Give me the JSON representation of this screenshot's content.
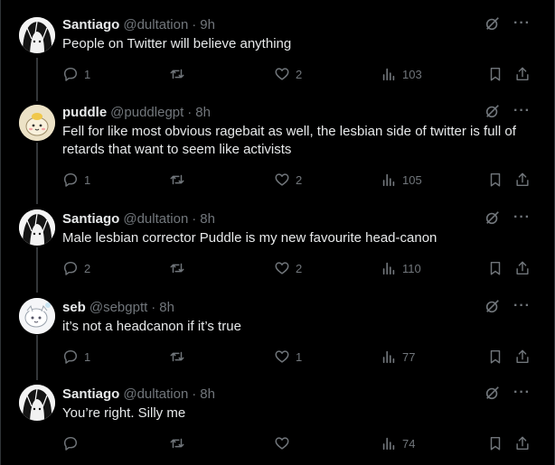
{
  "tweets": [
    {
      "name": "Santiago",
      "handle": "@dultation",
      "time": "9h",
      "text": "People on Twitter will believe anything",
      "replies": "1",
      "reposts": "",
      "likes": "2",
      "views": "103",
      "avatar": "anime-avatar"
    },
    {
      "name": "puddle",
      "handle": "@puddlegpt",
      "time": "8h",
      "text": "Fell for like most obvious ragebait as well, the lesbian side of twitter is full of retards that want to seem like activists",
      "replies": "1",
      "reposts": "",
      "likes": "2",
      "views": "105",
      "avatar": "cartoon-avatar"
    },
    {
      "name": "Santiago",
      "handle": "@dultation",
      "time": "8h",
      "text": "Male lesbian corrector Puddle is my new favourite head-canon",
      "replies": "2",
      "reposts": "",
      "likes": "2",
      "views": "110",
      "avatar": "anime-avatar"
    },
    {
      "name": "seb",
      "handle": "@sebgptt",
      "time": "8h",
      "text": "it’s not a headcanon if it’s true",
      "replies": "1",
      "reposts": "",
      "likes": "1",
      "views": "77",
      "avatar": "sketch-avatar"
    },
    {
      "name": "Santiago",
      "handle": "@dultation",
      "time": "8h",
      "text": "You’re right. Silly me",
      "replies": "",
      "reposts": "",
      "likes": "",
      "views": "74",
      "avatar": "anime-avatar"
    }
  ],
  "separator": "·",
  "more_glyph": "···",
  "colors": {
    "background": "#000000",
    "text": "#e7e9ea",
    "muted": "#71767b",
    "thread_line": "#333639"
  },
  "icons": [
    "reply-icon",
    "repost-icon",
    "like-icon",
    "views-icon",
    "bookmark-icon",
    "share-icon",
    "grok-icon",
    "more-icon"
  ]
}
